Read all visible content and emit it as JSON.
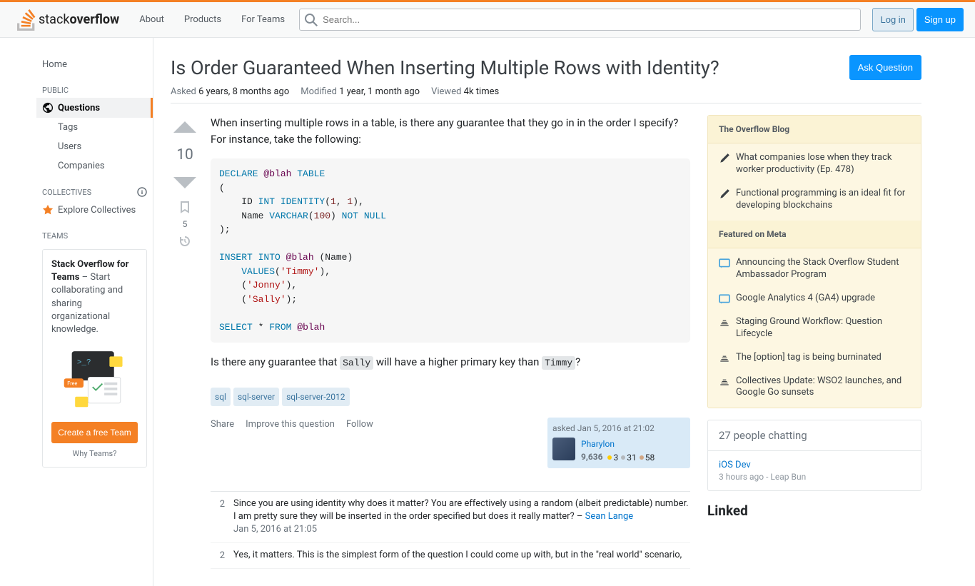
{
  "header": {
    "logo_text_1": "stack",
    "logo_text_2": "overflow",
    "nav": [
      "About",
      "Products",
      "For Teams"
    ],
    "search_placeholder": "Search...",
    "login": "Log in",
    "signup": "Sign up"
  },
  "sidebar": {
    "home": "Home",
    "public_header": "PUBLIC",
    "questions": "Questions",
    "tags": "Tags",
    "users": "Users",
    "companies": "Companies",
    "collectives_header": "COLLECTIVES",
    "explore_collectives": "Explore Collectives",
    "teams_header": "TEAMS",
    "teams_title": "Stack Overflow for Teams",
    "teams_desc": " – Start collaborating and sharing organizational knowledge.",
    "create_team": "Create a free Team",
    "why_teams": "Why Teams?"
  },
  "question": {
    "title": "Is Order Guaranteed When Inserting Multiple Rows with Identity?",
    "ask_button": "Ask Question",
    "asked_label": "Asked",
    "asked_value": "6 years, 8 months ago",
    "modified_label": "Modified",
    "modified_value": "1 year, 1 month ago",
    "viewed_label": "Viewed",
    "viewed_value": "4k times",
    "vote_count": "10",
    "bookmark_count": "5",
    "body_p1": "When inserting multiple rows in a table, is there any guarantee that they go in in the order I specify? For instance, take the following:",
    "body_p2_pre": "Is there any guarantee that ",
    "body_p2_code1": "Sally",
    "body_p2_mid": " will have a higher primary key than ",
    "body_p2_code2": "Timmy",
    "body_p2_end": "?",
    "tags": [
      "sql",
      "sql-server",
      "sql-server-2012"
    ],
    "share": "Share",
    "improve": "Improve this question",
    "follow": "Follow",
    "asked_time": "asked Jan 5, 2016 at 21:02",
    "author": "Pharylon",
    "rep": "9,636",
    "gold": "3",
    "silver": "31",
    "bronze": "58"
  },
  "comments": [
    {
      "score": "2",
      "text": "Since you are using identity why does it matter? You are effectively using a random (albeit predictable) number. I am pretty sure they will be inserted in the order specified but does it really matter? – ",
      "author": "Sean Lange",
      "date": "Jan 5, 2016 at 21:05"
    },
    {
      "score": "2",
      "text": "Yes, it matters. This is the simplest form of the question I could come up with, but in the \"real world\" scenario,",
      "author": "",
      "date": ""
    }
  ],
  "blog": {
    "header": "The Overflow Blog",
    "items": [
      "What companies lose when they track worker productivity (Ep. 478)",
      "Functional programming is an ideal fit for developing blockchains"
    ]
  },
  "meta": {
    "header": "Featured on Meta",
    "items": [
      "Announcing the Stack Overflow Student Ambassador Program",
      "Google Analytics 4 (GA4) upgrade",
      "Staging Ground Workflow: Question Lifecycle",
      "The [option] tag is being burninated",
      "Collectives Update: WSO2 launches, and Google Go sunsets"
    ]
  },
  "chat": {
    "header": "27 people chatting",
    "room": "iOS Dev",
    "meta": "3 hours ago - ",
    "user": "Leap Bun"
  },
  "linked": {
    "header": "Linked"
  }
}
